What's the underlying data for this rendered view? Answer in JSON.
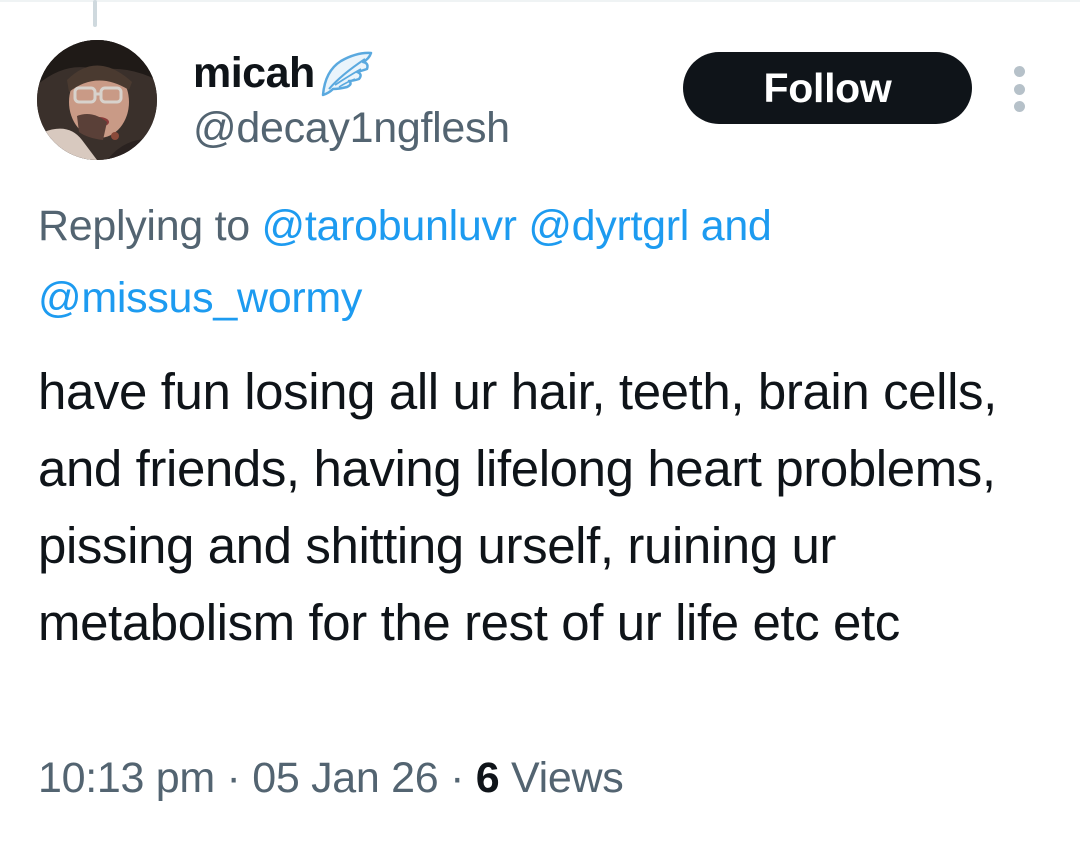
{
  "tweet": {
    "author": {
      "display_name": "micah",
      "name_emoji": "wing-icon",
      "handle": "@decay1ngflesh",
      "avatar": "avatar"
    },
    "follow_label": "Follow",
    "more_icon": "more-vertical-icon",
    "reply_context": {
      "prefix": "Replying to",
      "mentions": [
        "@tarobunluvr",
        "@dyrtgrl",
        "@missus_wormy"
      ],
      "conjunction": "and"
    },
    "text": "have fun losing all ur hair, teeth, brain cells, and friends, having lifelong heart problems, pissing and shitting urself, ruining ur metabolism for the rest of ur life etc etc",
    "time": "10:13 pm",
    "separator": "·",
    "date": "05 Jan 26",
    "views_count": "6",
    "views_label": "Views"
  },
  "colors": {
    "text_primary": "#0f1419",
    "text_secondary": "#536471",
    "mention": "#1d9bf0",
    "button_bg": "#0f1419",
    "button_text": "#ffffff"
  }
}
